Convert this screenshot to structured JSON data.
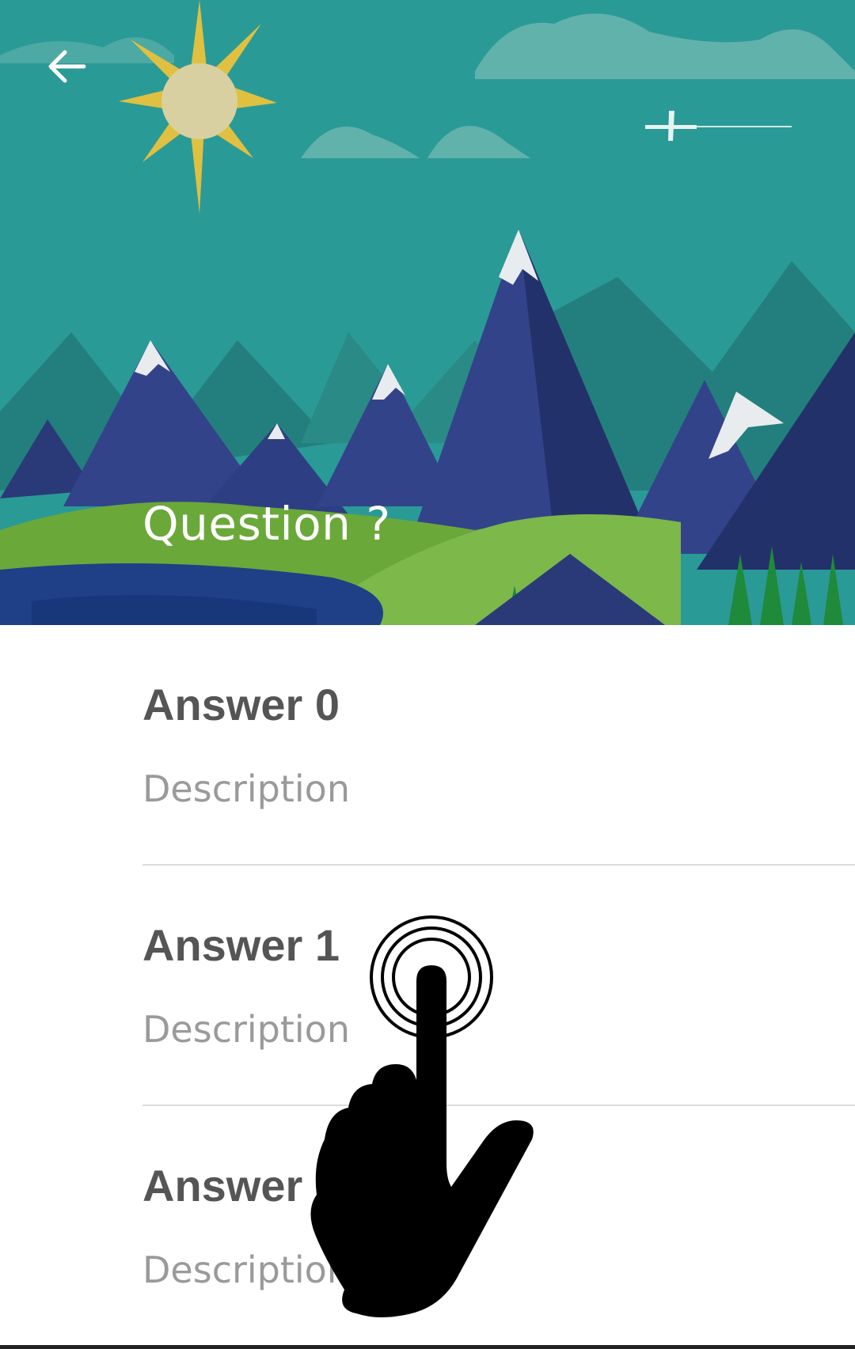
{
  "header": {
    "back_icon": "arrow-back-icon",
    "question": "Question ?",
    "background_color": "#2a9a96"
  },
  "answers": [
    {
      "title": "Answer 0",
      "description": "Description"
    },
    {
      "title": "Answer 1",
      "description": "Description"
    },
    {
      "title": "Answer 2",
      "description": "Description"
    }
  ],
  "overlay": {
    "icon": "tap-gesture-icon"
  }
}
